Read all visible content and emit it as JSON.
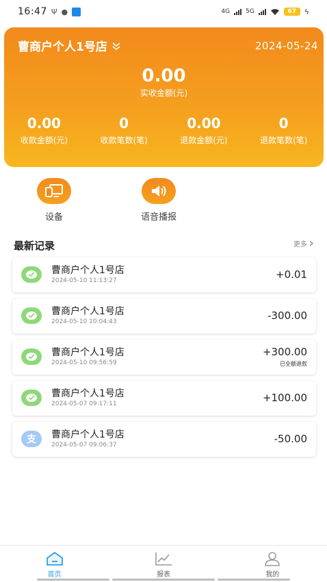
{
  "status_bar": {
    "time": "16:47",
    "network_1": "4G",
    "network_2": "5G",
    "battery": "67"
  },
  "summary": {
    "store_name": "曹商户个人1号店",
    "date": "2024-05-24",
    "main_amount": "0.00",
    "main_label": "实收金额(元)",
    "stats": [
      {
        "value": "0.00",
        "label": "收款金额(元)"
      },
      {
        "value": "0",
        "label": "收款笔数(笔)"
      },
      {
        "value": "0.00",
        "label": "退款金额(元)"
      },
      {
        "value": "0",
        "label": "退款笔数(笔)"
      }
    ],
    "accent_color": "#f28a1c"
  },
  "actions": [
    {
      "label": "设备",
      "icon": "devices-icon"
    },
    {
      "label": "语音播报",
      "icon": "speaker-icon"
    }
  ],
  "records_section": {
    "title": "最新记录",
    "more": "更多"
  },
  "records": [
    {
      "name": "曹商户个人1号店",
      "time": "2024-05-10 11:13:27",
      "amount": "+0.01",
      "note": "",
      "method": "wechat"
    },
    {
      "name": "曹商户个人1号店",
      "time": "2024-05-10 10:04:43",
      "amount": "-300.00",
      "note": "",
      "method": "wechat"
    },
    {
      "name": "曹商户个人1号店",
      "time": "2024-05-10 09:56:59",
      "amount": "+300.00",
      "note": "已全额退款",
      "method": "wechat"
    },
    {
      "name": "曹商户个人1号店",
      "time": "2024-05-07 09:17:11",
      "amount": "+100.00",
      "note": "",
      "method": "wechat"
    },
    {
      "name": "曹商户个人1号店",
      "time": "2024-05-07 09:06:37",
      "amount": "-50.00",
      "note": "",
      "method": "alipay",
      "method_glyph": "支"
    }
  ],
  "bottom_nav": [
    {
      "label": "首页",
      "icon": "home-icon",
      "active": true
    },
    {
      "label": "报表",
      "icon": "chart-icon",
      "active": false
    },
    {
      "label": "我的",
      "icon": "profile-icon",
      "active": false
    }
  ]
}
